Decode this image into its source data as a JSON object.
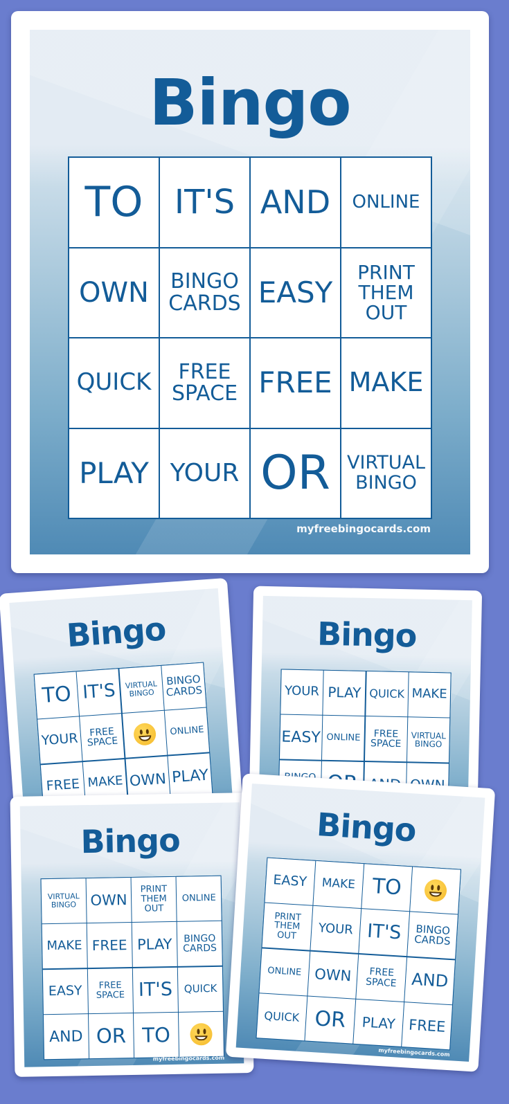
{
  "brand_color": "#135c98",
  "background_color": "#6a7dce",
  "watermark": "myfreebingocards.com",
  "cards": [
    {
      "id": "main",
      "title": "Bingo",
      "cells": [
        "TO",
        "IT'S",
        "AND",
        "ONLINE",
        "OWN",
        "BINGO\nCARDS",
        "EASY",
        "PRINT\nTHEM\nOUT",
        "QUICK",
        "FREE\nSPACE",
        "FREE",
        "MAKE",
        "PLAY",
        "YOUR",
        "OR",
        "VIRTUAL\nBINGO"
      ],
      "sizes": [
        60,
        48,
        46,
        26,
        40,
        30,
        42,
        28,
        34,
        30,
        42,
        38,
        42,
        36,
        68,
        27
      ]
    },
    {
      "id": "t1",
      "title": "Bingo",
      "cells": [
        "TO",
        "IT'S",
        "VIRTUAL\nBINGO",
        "BINGO\nCARDS",
        "YOUR",
        "FREE\nSPACE",
        "smiley-emoji",
        "ONLINE",
        "FREE",
        "MAKE",
        "OWN",
        "PLAY",
        "",
        "",
        "",
        ""
      ],
      "sizes": [
        30,
        26,
        11,
        15,
        19,
        14,
        0,
        13,
        19,
        18,
        21,
        22,
        12,
        12,
        12,
        12
      ]
    },
    {
      "id": "t2",
      "title": "Bingo",
      "cells": [
        "YOUR",
        "PLAY",
        "QUICK",
        "MAKE",
        "EASY",
        "ONLINE",
        "FREE\nSPACE",
        "VIRTUAL\nBINGO",
        "BINGO\nCARDS",
        "OR",
        "AND",
        "OWN",
        "",
        "",
        "",
        ""
      ],
      "sizes": [
        18,
        20,
        16,
        18,
        22,
        13,
        14,
        12,
        14,
        30,
        21,
        20,
        12,
        12,
        12,
        12
      ]
    },
    {
      "id": "t3",
      "title": "Bingo",
      "cells": [
        "VIRTUAL\nBINGO",
        "OWN",
        "PRINT\nTHEM\nOUT",
        "ONLINE",
        "MAKE",
        "FREE",
        "PLAY",
        "BINGO\nCARDS",
        "EASY",
        "FREE\nSPACE",
        "IT'S",
        "QUICK",
        "AND",
        "OR",
        "TO",
        "smiley-emoji"
      ],
      "sizes": [
        11,
        21,
        13,
        13,
        18,
        20,
        21,
        14,
        19,
        13,
        27,
        15,
        22,
        29,
        29,
        0
      ]
    },
    {
      "id": "t4",
      "title": "Bingo",
      "cells": [
        "EASY",
        "MAKE",
        "TO",
        "smiley-emoji",
        "PRINT\nTHEM\nOUT",
        "YOUR",
        "IT'S",
        "BINGO\nCARDS",
        "ONLINE",
        "OWN",
        "FREE\nSPACE",
        "AND",
        "QUICK",
        "OR",
        "PLAY",
        "FREE"
      ],
      "sizes": [
        19,
        17,
        30,
        0,
        13,
        18,
        27,
        15,
        13,
        21,
        14,
        24,
        16,
        30,
        20,
        21
      ]
    }
  ]
}
